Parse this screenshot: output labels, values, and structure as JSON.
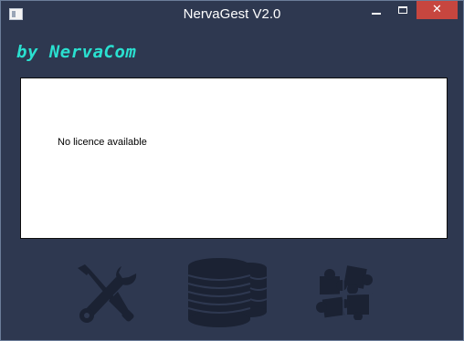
{
  "window": {
    "title": "NervaGest V2.0",
    "close_glyph": "✕",
    "background": "#2e3850"
  },
  "brand": {
    "text": "by NervaCom",
    "color": "#2ae0d0"
  },
  "panel": {
    "message": "No licence available"
  },
  "actions": [
    {
      "icon": "tools-icon"
    },
    {
      "icon": "database-icon"
    },
    {
      "icon": "puzzle-icon"
    }
  ],
  "colors": {
    "close_button": "#c7463f",
    "icon_fill": "#1b2233"
  }
}
